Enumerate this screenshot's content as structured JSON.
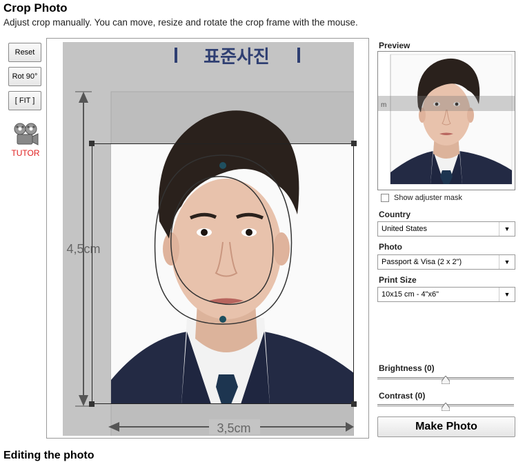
{
  "header": {
    "title": "Crop Photo",
    "subtitle": "Adjust crop manually. You can move, resize and rotate the crop frame with the mouse."
  },
  "tools": {
    "reset_label": "Reset",
    "rotate_label": "Rot 90°",
    "fit_label": "[ FIT ]",
    "tutor_label": "TUTOR"
  },
  "photo": {
    "korean_title": "표준사진",
    "height_label": "4,5cm",
    "width_label": "3,5cm"
  },
  "preview": {
    "label": "Preview",
    "mask_label": "Show adjuster mask",
    "mask_checked": false
  },
  "country": {
    "label": "Country",
    "value": "United States"
  },
  "photo_type": {
    "label": "Photo",
    "value": "Passport & Visa (2 x 2\")"
  },
  "print_size": {
    "label": "Print Size",
    "value": "10x15 cm - 4\"x6\""
  },
  "brightness": {
    "label": "Brightness (0)",
    "value": 0
  },
  "contrast": {
    "label": "Contrast (0)",
    "value": 0
  },
  "actions": {
    "make_photo_label": "Make Photo"
  },
  "footer": {
    "cut_heading": "Editing the photo"
  },
  "colors": {
    "suit": "#232a44",
    "tie": "#1d3550",
    "hair": "#2a211c",
    "skin": "#e8c2ac",
    "marker": "#1f4f5f"
  },
  "icons": [
    "film-projector-icon",
    "chevron-down-icon",
    "slider-thumb-icon"
  ]
}
